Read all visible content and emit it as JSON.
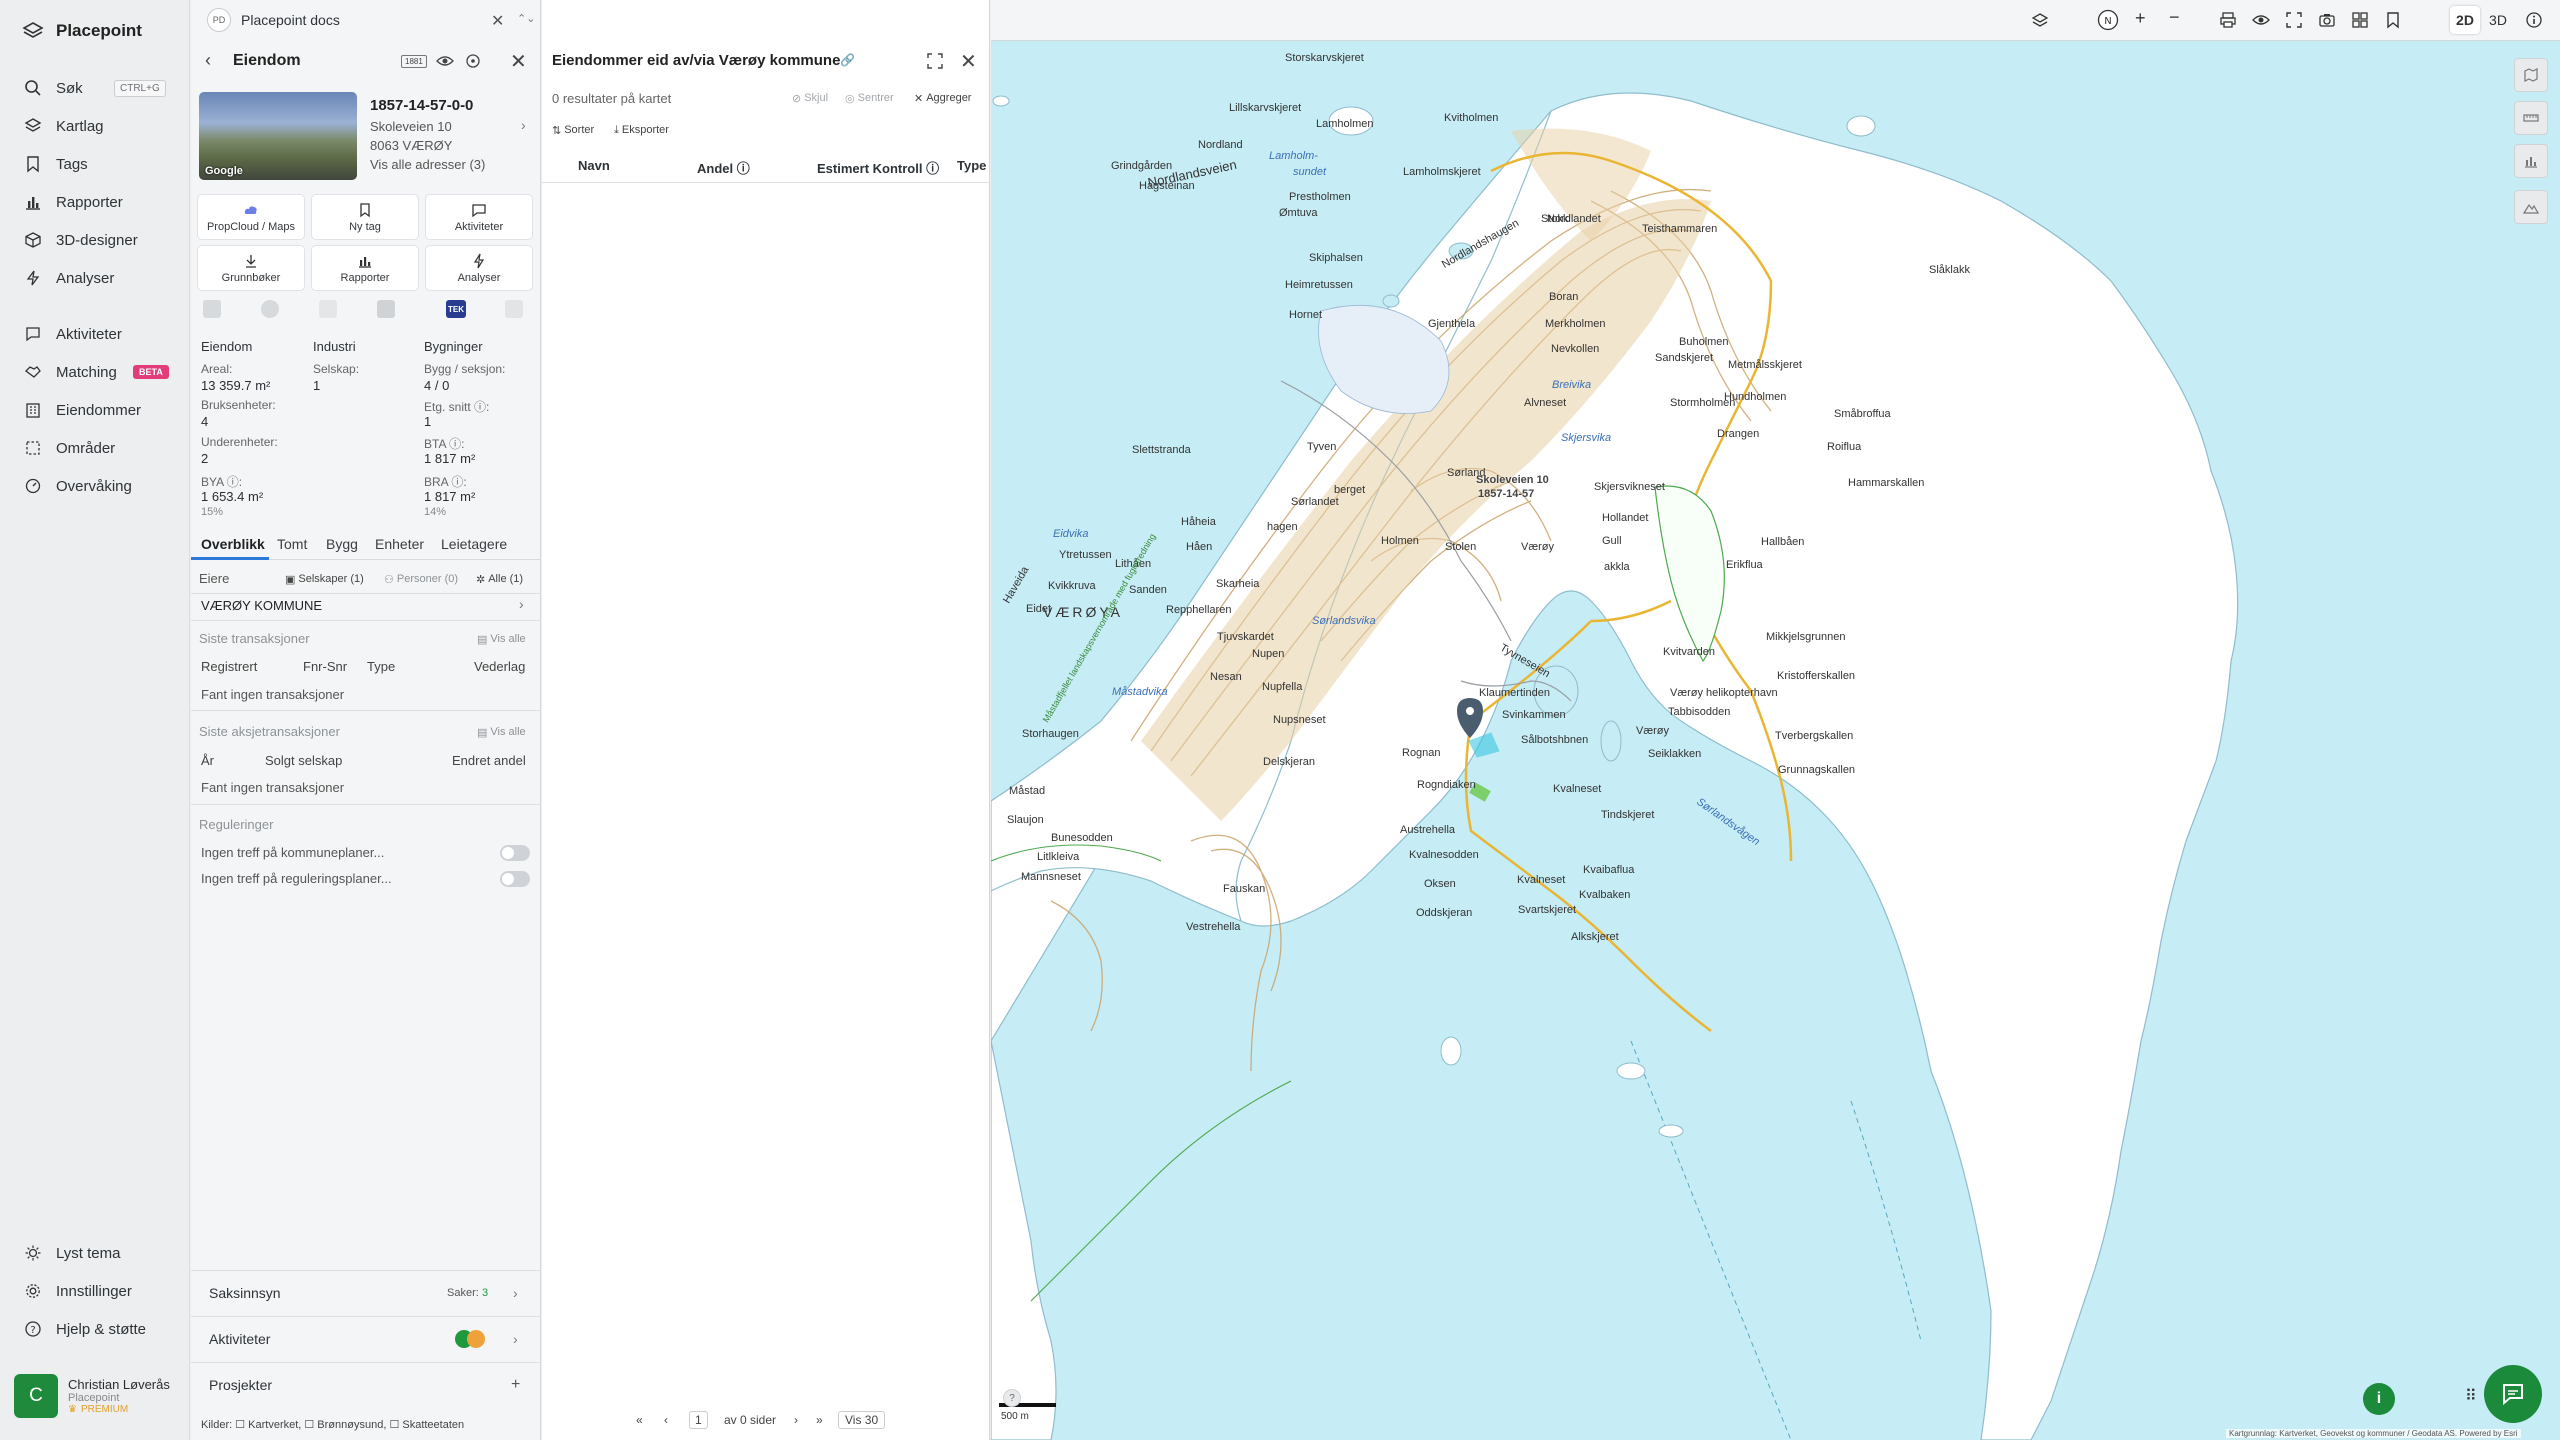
{
  "app": {
    "name": "Placepoint"
  },
  "nav": {
    "search": "Søk",
    "search_shortcut": "CTRL+G",
    "maplayers": "Kartlag",
    "tags": "Tags",
    "reports": "Rapporter",
    "designer": "3D-designer",
    "analyses": "Analyser",
    "activities": "Aktiviteter",
    "matching": "Matching",
    "matching_badge": "BETA",
    "properties": "Eiendommer",
    "areas": "Områder",
    "monitoring": "Overvåking",
    "theme": "Lyst tema",
    "settings": "Innstillinger",
    "help": "Hjelp & støtte",
    "user": {
      "initial": "C",
      "name": "Christian Løverås",
      "org": "Placepoint",
      "plan": "PREMIUM"
    }
  },
  "docs": {
    "badge": "PD",
    "title": "Placepoint docs"
  },
  "property": {
    "section_title": "Eiendom",
    "badge": "1881",
    "photo_label": "Google",
    "id": "1857-14-57-0-0",
    "street": "Skoleveien 10",
    "postal": "8063 VÆRØY",
    "all_addresses": "Vis alle adresser (3)",
    "tiles": [
      "PropCloud / Maps",
      "Ny tag",
      "Aktiviteter",
      "Grunnbøker",
      "Rapporter",
      "Analyser"
    ],
    "mini_tek": "TEK",
    "stats": {
      "h1": "Eiendom",
      "h2": "Industri",
      "h3": "Bygninger",
      "areal_l": "Areal:",
      "areal_v": "13 359.7 m²",
      "selskap_l": "Selskap:",
      "selskap_v": "1",
      "bygg_l": "Bygg / seksjon:",
      "bygg_v": "4 / 0",
      "bruks_l": "Bruksenheter:",
      "bruks_v": "4",
      "etg_l": "Etg. snitt ⓘ:",
      "etg_v": "1",
      "under_l": "Underenheter:",
      "under_v": "2",
      "bta_l": "BTA ⓘ:",
      "bta_v": "1 817 m²",
      "bya_l": "BYA ⓘ:",
      "bya_v": "1 653.4 m²",
      "bya_p": "15%",
      "bra_l": "BRA ⓘ:",
      "bra_v": "1 817 m²",
      "bra_p": "14%"
    },
    "tabs": [
      "Overblikk",
      "Tomt",
      "Bygg",
      "Enheter",
      "Leietagere"
    ],
    "owners": {
      "label": "Eiere",
      "companies": "Selskaper (1)",
      "persons": "Personer (0)",
      "all": "Alle (1)",
      "owner": "VÆRØY KOMMUNE"
    },
    "transactions": {
      "title": "Siste transaksjoner",
      "show_all": "Vis alle",
      "cols": [
        "Registrert",
        "Fnr-Snr",
        "Type",
        "Vederlag"
      ],
      "empty": "Fant ingen transaksjoner"
    },
    "share_transactions": {
      "title": "Siste aksjetransaksjoner",
      "show_all": "Vis alle",
      "cols": [
        "År",
        "Solgt selskap",
        "Endret andel"
      ],
      "empty": "Fant ingen transaksjoner"
    },
    "regulations": {
      "title": "Reguleringer",
      "r1": "Ingen treff på kommuneplaner...",
      "r2": "Ingen treff på reguleringsplaner..."
    },
    "saksinnsyn": {
      "label": "Saksinnsyn",
      "count_label": "Saker:",
      "count": "3"
    },
    "activities_label": "Aktiviteter",
    "projects_label": "Prosjekter",
    "sources": "Kilder: ☐ Kartverket, ☐ Brønnøysund, ☐ Skatteetaten"
  },
  "results": {
    "title": "Eiendommer eid av/via Værøy kommune",
    "count": "0 resultater på kartet",
    "hide": "Skjul",
    "center": "Sentrer",
    "aggregate": "Aggreger",
    "sort": "Sorter",
    "export": "Eksporter",
    "cols": [
      "Navn",
      "Andel ⓘ",
      "Estimert Kontroll ⓘ",
      "Type"
    ],
    "pager": {
      "page": "1",
      "of": "av 0 sider",
      "per_page": "Vis 30"
    }
  },
  "map": {
    "modes": [
      "2D",
      "3D"
    ],
    "scale": "500 m",
    "marker_label_1": "Skoleveien 10",
    "marker_label_2": "1857-14-57",
    "attribution": "Kartgrunnlag: Kartverket, Geovekst og kommuner / Geodata AS. Powered by Esri",
    "labels": {
      "island": "VÆRØYA",
      "storskarv": "Storskarvskjeret",
      "lillskarv": "Lillskarvskjeret",
      "lamholmen": "Lamholmen",
      "kvitholmen": "Kvitholmen",
      "nordland": "Nordland",
      "grindgarden": "Grindgården",
      "lamholmsund": "Lamholm-",
      "sundet": "sundet",
      "lamholmsk": "Lamholmskjeret",
      "nordlandsveien": "Nordlandsveien",
      "presthol": "Presthol­men",
      "stokk": "Stokk",
      "hagsteinan": "Hagsteinan",
      "omtuva": "Ømtuva",
      "nordlandhaugen": "Nordlandshaugen",
      "nordlandet": "Nordlandet",
      "teisham": "Teisthammaren",
      "skiphals": "Skiphalsen",
      "heimretussen": "Heimretussen",
      "slaklak": "Slåklakk",
      "boran": "Boran",
      "hornet": "Hornet",
      "gjenthela": "Gjenthela",
      "mertholm": "Merkholmen",
      "nevkollen": "Nevkollen",
      "buholmen": "Buholmen",
      "sandskjeret": "Sandskjeret",
      "metmalsk": "Metmålsskjeret",
      "hundholmen": "Hundholmen",
      "smabroff": "Småbroffua",
      "breivika": "Breivika",
      "alvneset": "Alvneset",
      "stormholmen": "Stormholmen",
      "drangen": "Drangen",
      "skjersvika": "Skjersvika",
      "roiflua": "Roiflua",
      "slettstranda": "Slettstranda",
      "tyven": "Tyven",
      "sorland": "Sørland",
      "hammarskallen": "Hammarskallen",
      "skjersvikneset": "Skjersvikneset",
      "hollandet": "Holl­andet",
      "sorlandet": "Sørlandet",
      "berget": "berget",
      "haheia": "Håheia",
      "hagen": "hagen",
      "holmen": "Holmen",
      "stolen": "Stolen",
      "varoy": "Værøy",
      "gull": "Gull",
      "eidvika": "Eidvika",
      "ytretussen": "Ytretussen",
      "haen": "Håen",
      "hallbaen": "Hallbåen",
      "lithaen": "Lithåen",
      "akkla": "akkla",
      "erikflua": "Erikflua",
      "kvikkruva": "Kvikkruva",
      "sanden": "Sanden",
      "skarheia": "Skarheia",
      "eidet": "Eidet",
      "repphellaren": "Repphellaren",
      "sorlandsvika": "Sørlandsvika",
      "mikkjelsgrunnen": "Mikkjelsgrunnen",
      "tjuvskardet": "Tjuvskardet",
      "kvitvarden": "Kvitvarden",
      "nupen": "Nupen",
      "tyvnesveien": "Tyvneseien",
      "nesan": "Nesan",
      "nupfella": "Nupfella",
      "kristofferskalen": "Kristofferskallen",
      "helikopter": "Værøy helikopterhavn",
      "mastadvika": "Måstadvika",
      "klaumertinden": "Klaumertinden",
      "tabbisodden": "Tabbisodden",
      "nupsneset": "Nupsneset",
      "svinkammen": "Svinkammen",
      "storhaugen": "Storhaugen",
      "varoy2": "Værøy",
      "tverberg": "Tverbergskallen",
      "delskjeran": "Delskjeran",
      "solbotshbn": "Sålbotshbnen",
      "seiklakken": "Seiklakken",
      "grunnagskallen": "Grunnagskallen",
      "rognan": "Rognan",
      "mastad": "Måstad",
      "rogndiaken": "Rogndiaken",
      "kvalneset": "Kvalneset",
      "sauejon": "Slaujon",
      "tindskjeret": "Tindskjeret",
      "sorlandsvagen": "Sørlandsvågen",
      "austrehella": "Austrehella",
      "bunesodden": "Bunesodden",
      "litlkleiva": "Litlkleiva",
      "kvalnesodden": "Kvalnesodden",
      "kvaibaflua": "Kvaibaflua",
      "mannsneset": "Mannsneset",
      "kvalneset2": "Kvalneset",
      "oksen": "Oksen",
      "kvalbaken": "Kvalbaken",
      "fauskan": "Fauskan",
      "oddskjeran": "Oddskjeran",
      "svartskjeret": "Svartskjeret",
      "vestrehella": "Vestrehella",
      "alkskjeret": "Alkskjeret",
      "mastadfjellet": "Måstadfjellet landskapsvernområde med fuglefredning",
      "haveida": "Haveida"
    }
  }
}
